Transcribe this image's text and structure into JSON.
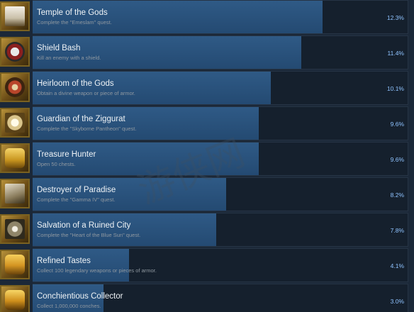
{
  "achievements": [
    {
      "title": "Temple of the Gods",
      "description": "Complete the \"Emeslam\" quest.",
      "percent": "12.3%",
      "percent_value": 12.3,
      "icon": "temple-icon"
    },
    {
      "title": "Shield Bash",
      "description": "Kill an enemy with a shield.",
      "percent": "11.4%",
      "percent_value": 11.4,
      "icon": "shield-icon"
    },
    {
      "title": "Heirloom of the Gods",
      "description": "Obtain a divine weapon or piece of armor.",
      "percent": "10.1%",
      "percent_value": 10.1,
      "icon": "heirloom-icon"
    },
    {
      "title": "Guardian of the Ziggurat",
      "description": "Complete the \"Skyborne Pantheon\" quest.",
      "percent": "9.6%",
      "percent_value": 9.6,
      "icon": "ziggurat-icon"
    },
    {
      "title": "Treasure Hunter",
      "description": "Open 50 chests.",
      "percent": "9.6%",
      "percent_value": 9.6,
      "icon": "treasure-icon"
    },
    {
      "title": "Destroyer of Paradise",
      "description": "Complete the \"Gamma IV\" quest.",
      "percent": "8.2%",
      "percent_value": 8.2,
      "icon": "destroyer-icon"
    },
    {
      "title": "Salvation of a Ruined City",
      "description": "Complete the \"Heart of the Blue Sun\" quest.",
      "percent": "7.8%",
      "percent_value": 7.8,
      "icon": "salvation-icon"
    },
    {
      "title": "Refined Tastes",
      "description": "Collect 100 legendary weapons or pieces of armor.",
      "percent": "4.1%",
      "percent_value": 4.1,
      "icon": "refined-icon"
    },
    {
      "title": "Conchientious Collector",
      "description": "Collect 1,000,000 conches.",
      "percent": "3.0%",
      "percent_value": 3.0,
      "icon": "collector-icon"
    }
  ],
  "watermark": "游侠网",
  "colors": {
    "background": "#1b2838",
    "bar_fill": "#2f5a86",
    "title": "#eef2f5",
    "description": "#8f98a0",
    "percent": "#8fc3ff"
  }
}
